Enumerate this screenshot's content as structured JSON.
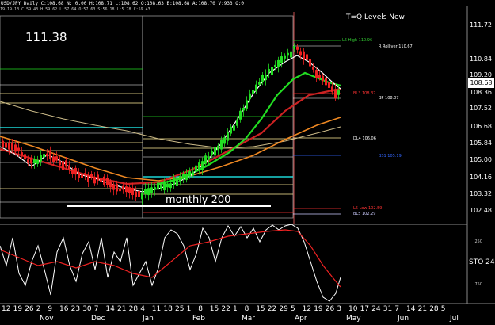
{
  "header": {
    "title": "USD/JPY Daily  C:108.68  N: 0.00  H:108.71  L:108.62  O:108.63  B:108.68  A:108.70  V:933  O:0",
    "sub": "19-19-13  C:59.43  H:59.62  L:57.64  O:57.63  S:56.18  L:5.78  C:59.43"
  },
  "current_price_label": "111.38",
  "system_label": "T=Q Levels New",
  "monthly_label": "monthly 200",
  "price_axis": [
    "111.72",
    "110.84",
    "109.20",
    "108.36",
    "107.52",
    "106.68",
    "105.84",
    "105.00",
    "104.16",
    "103.32",
    "102.48"
  ],
  "current_price": "108.68",
  "level_labels": [
    {
      "text": "L6 High 110.96",
      "color": "#33cc33"
    },
    {
      "text": "R Rolliver 110.67",
      "color": "#ffffff"
    },
    {
      "text": "BL3 108.37",
      "color": "#ff3333"
    },
    {
      "text": "BP 108.07",
      "color": "#ffffff"
    },
    {
      "text": "DL4 106.06",
      "color": "#ffffff"
    },
    {
      "text": "BS1 105.19",
      "color": "#3366ff"
    },
    {
      "text": "L6 Low 102.59",
      "color": "#ff3333"
    },
    {
      "text": "BL5 102.29",
      "color": "#ccccff"
    }
  ],
  "osc": {
    "label": "STO 24",
    "levels": [
      "250",
      "750"
    ]
  },
  "x_ticks": [
    "12",
    "19",
    "26",
    "2",
    "9",
    "16",
    "23",
    "30",
    "7",
    "14",
    "21",
    "28",
    "4",
    "11",
    "18",
    "25",
    "1",
    "8",
    "15",
    "22",
    "1",
    "8",
    "15",
    "22",
    "29",
    "5",
    "12",
    "19",
    "26",
    "3",
    "10",
    "17",
    "24",
    "31",
    "7",
    "14",
    "21",
    "28",
    "5"
  ],
  "months": [
    "Nov",
    "Dec",
    "Jan",
    "Feb",
    "Mar",
    "Apr",
    "May",
    "Jun",
    "Jul"
  ],
  "colors": {
    "up": "#22dd22",
    "down": "#ee2222",
    "ema_white": "#ffffff",
    "ema_green": "#22dd22",
    "ema_red": "#cc2222",
    "ema_orange": "#ee8822",
    "ema_tan": "#ccbb88"
  }
}
